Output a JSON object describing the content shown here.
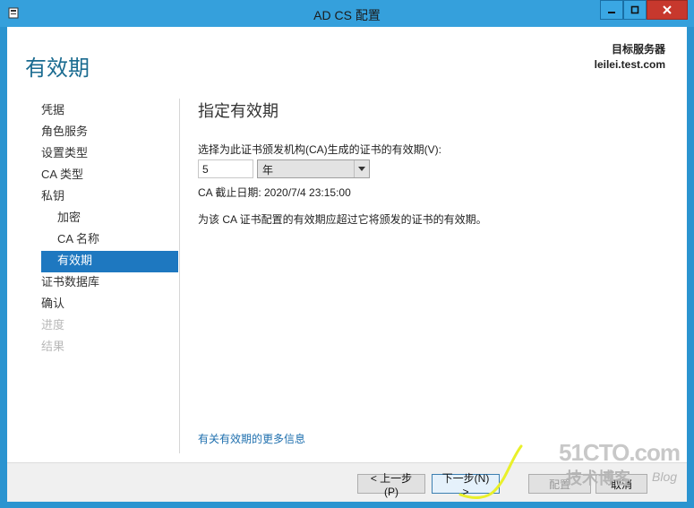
{
  "window": {
    "title": "AD CS 配置"
  },
  "header": {
    "page_title": "有效期",
    "target_label": "目标服务器",
    "target_name": "leilei.test.com"
  },
  "nav": {
    "items": [
      {
        "label": "凭据",
        "state": "normal",
        "sub": false
      },
      {
        "label": "角色服务",
        "state": "normal",
        "sub": false
      },
      {
        "label": "设置类型",
        "state": "normal",
        "sub": false
      },
      {
        "label": "CA 类型",
        "state": "normal",
        "sub": false
      },
      {
        "label": "私钥",
        "state": "normal",
        "sub": false
      },
      {
        "label": "加密",
        "state": "normal",
        "sub": true
      },
      {
        "label": "CA 名称",
        "state": "normal",
        "sub": true
      },
      {
        "label": "有效期",
        "state": "active",
        "sub": true
      },
      {
        "label": "证书数据库",
        "state": "normal",
        "sub": false
      },
      {
        "label": "确认",
        "state": "normal",
        "sub": false
      },
      {
        "label": "进度",
        "state": "disabled",
        "sub": false
      },
      {
        "label": "结果",
        "state": "disabled",
        "sub": false
      }
    ]
  },
  "main": {
    "section_title": "指定有效期",
    "prompt": "选择为此证书颁发机构(CA)生成的证书的有效期(V):",
    "validity_value": "5",
    "validity_unit": "年",
    "expiry_text": "CA 截止日期: 2020/7/4 23:15:00",
    "note": "为该 CA 证书配置的有效期应超过它将颁发的证书的有效期。",
    "more_link": "有关有效期的更多信息"
  },
  "footer": {
    "prev": "< 上一步(P)",
    "next": "下一步(N) >",
    "config": "配置",
    "cancel": "取消"
  },
  "watermark": {
    "top": "51CTO.com",
    "bottom": "技术博客",
    "blog": "Blog"
  }
}
